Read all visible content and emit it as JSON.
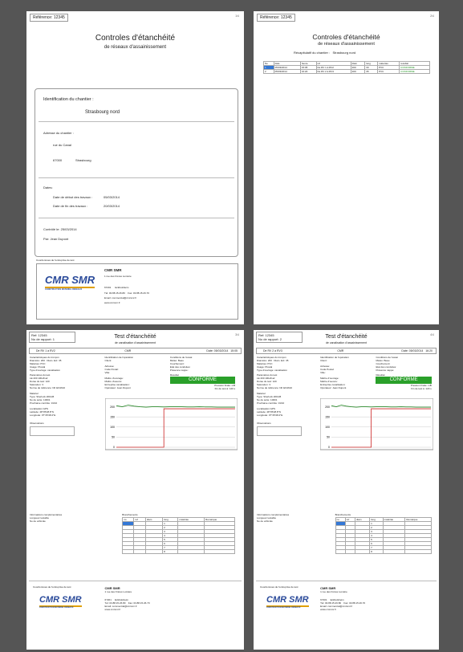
{
  "header": {
    "ref_label": "Référence:",
    "ref_value": "12345"
  },
  "page1": {
    "page_num": "1/4",
    "title": "Controles d'étanchéité",
    "subtitle": "de réseaux d'assainissement",
    "id_title": "Identification du chantier :",
    "chantier_name": "Strasbourg nord",
    "address_label": "Adresse du chantier :",
    "street": "rue du Canal",
    "postcode": "67000",
    "city": "Strasbourg",
    "dates_label": "Dates:",
    "date_debut_label": "Date de début des travaux :",
    "date_debut": "05/03/2014",
    "date_fin_label": "Date de fin des travaux :",
    "date_fin": "20/03/2014",
    "controle_label": "Contrôlé le:",
    "controle_date": "25/03/2014",
    "par_label": "Par:",
    "par_name": "Jean Dupont",
    "coord_label": "Coordonnées de l'entreprise de test"
  },
  "company": {
    "logo": "CMR SMR",
    "logo_sub": "CONSTRUCTION MATERIEL RESEAUX",
    "name": "CMR SMR",
    "street": "1 rue des Frères Lumière",
    "postcode": "67201",
    "city": "Eckbolsheim",
    "tel_label": "Tél:",
    "tel": "03.88.15.26.80",
    "fax_label": "Fax:",
    "fax": "03.88.15.26.70",
    "email_label": "Email:",
    "email": "commercial@cmrsmr.fr",
    "web": "www.cmrsmr.fr"
  },
  "page2": {
    "page_num": "2/4",
    "title": "Controles d'étanchéité",
    "subtitle": "de réseaux d'assainissement",
    "recap_label": "Récapitulatif du chantier :",
    "recap_value": "Strasbourg nord",
    "columns": [
      "No",
      "date",
      "heure",
      "ref",
      "diam",
      "long",
      "materiau",
      "resultat"
    ],
    "rows": [
      {
        "no": "1",
        "date": "05/03/2014",
        "heure": "15:05",
        "ref": "De RV 1 à RV2",
        "diam": "200",
        "long": "30",
        "mat": "PVC",
        "res": "CONFORME"
      },
      {
        "no": "2",
        "date": "05/03/2014",
        "heure": "16:20",
        "ref": "De RV 2 à RV3",
        "diam": "200",
        "long": "35",
        "mat": "PVC",
        "res": "CONFORME"
      }
    ]
  },
  "tests": [
    {
      "page_num": "3/4",
      "ref_label": "Ref:",
      "ref": "12345",
      "rapport_label": "No de rapport:",
      "rapport": "1",
      "title": "Test d'étanchéité",
      "subtitle": "de canalisation d'assainissement",
      "troncon": "De RV 1 à RV2",
      "company": "CMR",
      "date_label": "Date:",
      "date": "05/03/2014",
      "time": "15:05",
      "left": {
        "c_troncon": "Caractéristiques du tronçon",
        "diam_label": "Diamètre:",
        "diam": "200",
        "diam2_label": "Diam. Ext:",
        "diam2": "35",
        "mat_label": "Matériau:",
        "mat": "PVC",
        "usage_label": "Usage:",
        "usage": "Pluvial",
        "ouvrage_label": "Type d'ouvrage:",
        "ouvrage": "canalisation",
        "params": "Paramètres du test",
        "param1": "LE 200 10bs8 air",
        "duree_label": "Durée du test:",
        "duree": "120",
        "sat_label": "Saturation:",
        "sat": "3",
        "norme_label": "Norme de référence:",
        "norme": "NF EN1610",
        "mat2": "Matériel",
        "type_label": "Type:",
        "type": "Sherlock 200mB",
        "serie_label": "No de série:",
        "serie": "10001",
        "cal_label": "Prochaine contrôle:",
        "cal": "31/10",
        "gps": "Localisation GPS",
        "lat_label": "Latitude:",
        "lat": "48°35'28.8\"N",
        "lon_label": "Longitude:",
        "lon": "07°45'48.2\"E",
        "obs": "Observations"
      },
      "mid": {
        "l1": "Identification de l'opération",
        "l2": "Client:",
        "l3": "Adresse:",
        "l4": "Code Postal:",
        "l5": "Ville:",
        "l6": "Maître d'ouvrage:",
        "l7": "Maître d'oeuvre:",
        "l8": "Entreprise canalisation:",
        "l9": "Opérateur:",
        "operator": "Jean Dupont"
      },
      "right": {
        "r1": "Conditions de l'essai",
        "r2": "Météo:",
        "meteo": "Beau",
        "r3": "Couchement:",
        "r4": "Etat des conduites:",
        "r5": "Présence nappe:",
        "result_label": "Résultat",
        "result": "CONFORME",
        "press_label": "Pression finale:",
        "press": "mB",
        "fin_label": "Fin de test à:",
        "fin": "120 s"
      },
      "info_title": "Informations complémentaires",
      "info1": "Longueur testable",
      "info2": "No de véhicule",
      "branch_title": "Branchements",
      "branch_cols": [
        "no",
        "ref",
        "diam",
        "long",
        "matériau",
        "Remarque"
      ],
      "branch_rows": [
        "1",
        "2",
        "3",
        "4",
        "5",
        "6",
        "7",
        "8"
      ],
      "coord_label": "Coordonnées de l'entreprise de test"
    },
    {
      "page_num": "4/4",
      "ref_label": "Ref:",
      "ref": "12345",
      "rapport_label": "No de rapport:",
      "rapport": "2",
      "title": "Test d'étanchéité",
      "subtitle": "de canalisation d'assainissement",
      "troncon": "De RV 2 à RV3",
      "company": "CMR",
      "date_label": "Date:",
      "date": "05/03/2014",
      "time": "16:20",
      "left": {
        "c_troncon": "Caractéristiques du tronçon",
        "diam_label": "Diamètre:",
        "diam": "200",
        "diam2_label": "Diam. Ext:",
        "diam2": "35",
        "mat_label": "Matériau:",
        "mat": "PVC",
        "usage_label": "Usage:",
        "usage": "Pluvial",
        "ouvrage_label": "Type d'ouvrage:",
        "ouvrage": "canalisation",
        "params": "Paramètres du test",
        "param1": "LE 200 10bs8 air",
        "duree_label": "Durée du test:",
        "duree": "120",
        "sat_label": "Saturation:",
        "sat": "3",
        "norme_label": "Norme de référence:",
        "norme": "NF EN1610",
        "mat2": "Matériel",
        "type_label": "Type:",
        "type": "Sherlock 200mB",
        "serie_label": "No de série:",
        "serie": "10001",
        "cal_label": "Prochaine contrôle:",
        "cal": "31/10",
        "gps": "Localisation GPS",
        "lat_label": "Latitude:",
        "lat": "48°35'28.8\"N",
        "lon_label": "Longitude:",
        "lon": "07°45'48.2\"E",
        "obs": "Observations"
      },
      "mid": {
        "l1": "Identification de l'opération",
        "l2": "Client:",
        "l3": "Adresse:",
        "l4": "Code Postal:",
        "l5": "Ville:",
        "l6": "Maître d'ouvrage:",
        "l7": "Maître d'oeuvre:",
        "l8": "Entreprise canalisation:",
        "l9": "Opérateur:",
        "operator": "Jean Dupont"
      },
      "right": {
        "r1": "Conditions de l'essai",
        "r2": "Météo:",
        "meteo": "Beau",
        "r3": "Couchement:",
        "r4": "Etat des conduites:",
        "r5": "Présence nappe:",
        "result_label": "Résultat",
        "result": "CONFORME",
        "press_label": "Pression finale:",
        "press": "mB",
        "fin_label": "Fin de test à:",
        "fin": "120 s"
      },
      "info_title": "Informations complémentaires",
      "info1": "Longueur testable",
      "info2": "No de véhicule",
      "branch_title": "Branchements",
      "branch_cols": [
        "no",
        "ref",
        "diam",
        "long",
        "matériau",
        "Remarque"
      ],
      "branch_rows": [
        "1",
        "2",
        "3",
        "4",
        "5",
        "6",
        "7",
        "8"
      ],
      "coord_label": "Coordonnées de l'entreprise de test"
    }
  ],
  "chart_data": [
    {
      "type": "line",
      "yticks": [
        "0",
        "50",
        "100",
        "150",
        "200"
      ],
      "ylim": [
        0,
        230
      ],
      "series": [
        {
          "color": "#2a8a2a",
          "x": [
            0,
            2,
            4,
            6,
            8,
            10,
            12,
            14,
            16,
            18,
            20,
            22,
            24,
            26,
            28,
            30,
            32,
            34,
            36,
            38,
            40
          ],
          "values": [
            205,
            200,
            208,
            203,
            200,
            198,
            200,
            200,
            199,
            200,
            200,
            200,
            199,
            199,
            200,
            199,
            199,
            198,
            198,
            198,
            198
          ]
        },
        {
          "color": "#cc2222",
          "x": [
            0,
            16,
            16,
            40
          ],
          "values": [
            0,
            0,
            190,
            190
          ]
        }
      ],
      "colors": {
        "pass": "#2aa02a"
      }
    }
  ]
}
